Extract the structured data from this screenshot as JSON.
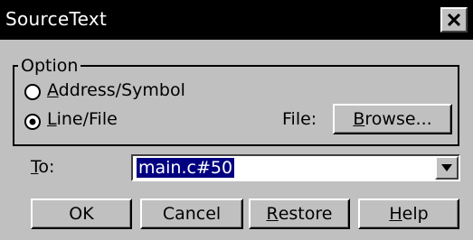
{
  "window": {
    "title": "SourceText"
  },
  "option_group": {
    "label": "Option",
    "address_symbol": {
      "label_underlined": "A",
      "label_rest": "ddress/Symbol",
      "selected": false
    },
    "line_file": {
      "label_underlined": "L",
      "label_rest": "ine/File",
      "selected": true
    },
    "file_label": "File:",
    "browse_button": {
      "label_underlined": "B",
      "label_rest": "rowse..."
    }
  },
  "to": {
    "label_underlined": "T",
    "label_rest": "o:",
    "value": "main.c#50"
  },
  "buttons": {
    "ok": "OK",
    "cancel": "Cancel",
    "restore": {
      "label_underlined": "R",
      "label_rest": "estore"
    },
    "help": {
      "label_underlined": "H",
      "label_rest": "elp"
    }
  },
  "icons": {
    "close": "close-icon",
    "dropdown": "chevron-down-icon"
  },
  "colors": {
    "titlebar_bg": "#000000",
    "window_bg": "#c0c0c0",
    "selection_bg": "#000080"
  }
}
